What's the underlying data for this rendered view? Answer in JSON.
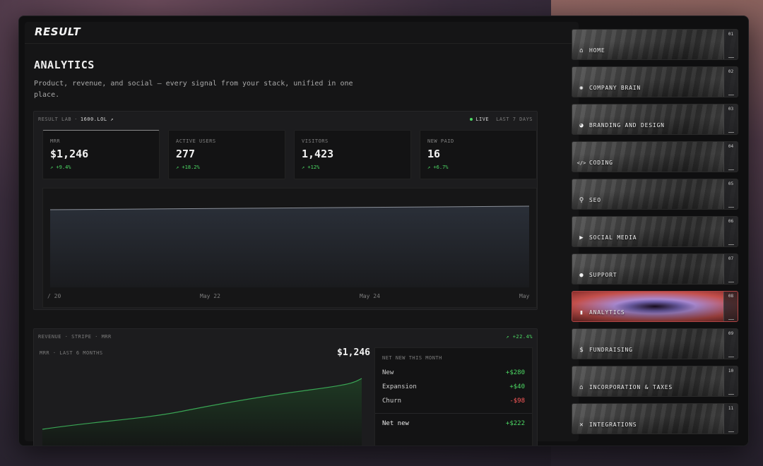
{
  "app": {
    "logo": "RESULT"
  },
  "page": {
    "title": "ANALYTICS",
    "subtitle": "Product, revenue, and social — every signal from your stack, unified in one place."
  },
  "overview_panel": {
    "source": "RESULT LAB",
    "separator": "·",
    "link": "1600.LOL ↗",
    "live_label": "LIVE",
    "range_label": "LAST 7 DAYS",
    "stats": [
      {
        "label": "MRR",
        "value": "$1,246",
        "delta": "↗ +9.4%"
      },
      {
        "label": "ACTIVE USERS",
        "value": "277",
        "delta": "↗ +18.2%"
      },
      {
        "label": "VISITORS",
        "value": "1,423",
        "delta": "↗ +12%"
      },
      {
        "label": "NEW PAID",
        "value": "16",
        "delta": "↗ +6.7%"
      }
    ],
    "x_ticks": [
      "/ 20",
      "May 22",
      "May 24",
      "May"
    ]
  },
  "revenue_panel": {
    "header": "REVENUE · STRIPE · MRR",
    "header_delta": "↗ +22.4%",
    "sub_header": "MRR · LAST 6 MONTHS",
    "value": "$1,246",
    "net_title": "NET NEW THIS MONTH",
    "rows": [
      {
        "label": "New",
        "value": "+$280"
      },
      {
        "label": "Expansion",
        "value": "+$40"
      },
      {
        "label": "Churn",
        "value": "-$98"
      }
    ],
    "total": {
      "label": "Net new",
      "value": "+$222"
    }
  },
  "sidebar": {
    "items": [
      {
        "num": "01",
        "label": "HOME",
        "icon": "home-icon"
      },
      {
        "num": "02",
        "label": "COMPANY BRAIN",
        "icon": "brain-icon"
      },
      {
        "num": "03",
        "label": "BRANDING AND DESIGN",
        "icon": "palette-icon"
      },
      {
        "num": "04",
        "label": "CODING",
        "icon": "code-icon"
      },
      {
        "num": "05",
        "label": "SEO",
        "icon": "search-icon"
      },
      {
        "num": "06",
        "label": "SOCIAL MEDIA",
        "icon": "megaphone-icon"
      },
      {
        "num": "07",
        "label": "SUPPORT",
        "icon": "chat-icon"
      },
      {
        "num": "08",
        "label": "ANALYTICS",
        "icon": "bar-chart-icon"
      },
      {
        "num": "09",
        "label": "FUNDRAISING",
        "icon": "dollar-icon"
      },
      {
        "num": "10",
        "label": "INCORPORATION & TAXES",
        "icon": "bank-icon"
      },
      {
        "num": "11",
        "label": "INTEGRATIONS",
        "icon": "plug-icon"
      }
    ]
  },
  "colors": {
    "positive": "#4cd964",
    "negative": "#ff5a5a",
    "accent_selected": "#c4504c"
  }
}
